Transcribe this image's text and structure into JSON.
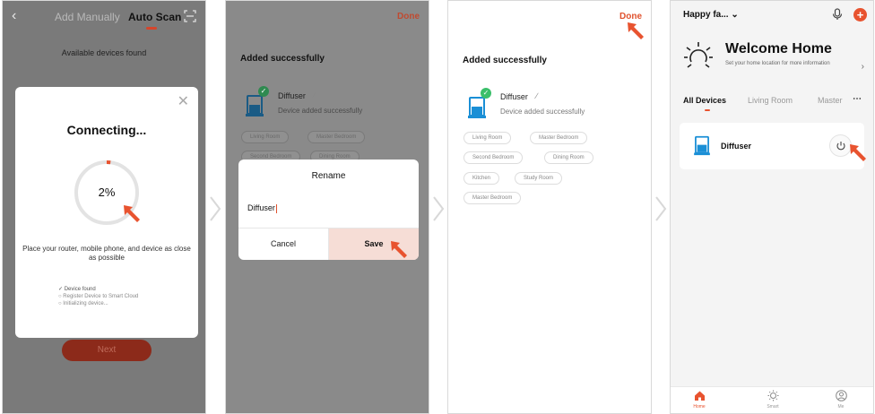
{
  "screen1": {
    "tabs": {
      "manual": "Add Manually",
      "auto": "Auto Scan"
    },
    "found_text": "Available devices found",
    "dialog": {
      "title": "Connecting...",
      "progress_text": "2%",
      "progress": 0.02,
      "note": "Place your router, mobile phone, and device as close as possible",
      "steps": [
        {
          "label": "Device found",
          "status": "done"
        },
        {
          "label": "Register Device to Smart Cloud",
          "status": "pending"
        },
        {
          "label": "Initializing device...",
          "status": "pending"
        }
      ]
    },
    "next_label": "Next"
  },
  "screen2": {
    "done_label": "Done",
    "added_title": "Added successfully",
    "device": {
      "name": "Diffuser",
      "subtitle": "Device added successfully"
    },
    "rooms": [
      "Living Room",
      "Master Bedroom",
      "Second Bedroom",
      "Dining Room"
    ],
    "rename_dialog": {
      "title": "Rename",
      "input_value": "Diffuser",
      "cancel_label": "Cancel",
      "save_label": "Save"
    }
  },
  "screen3": {
    "done_label": "Done",
    "added_title": "Added successfully",
    "device": {
      "name": "Diffuser",
      "subtitle": "Device added successfully"
    },
    "rooms": [
      "Living Room",
      "Master Bedroom",
      "Second Bedroom",
      "Dining Room",
      "Kitchen",
      "Study Room",
      "Master Bedroom"
    ]
  },
  "screen4": {
    "home_name": "Happy fa...",
    "welcome_title": "Welcome Home",
    "location_hint": "Set your home location for more information",
    "tabs": [
      "All Devices",
      "Living Room",
      "Master"
    ],
    "device_name": "Diffuser",
    "nav": [
      "Home",
      "Smart",
      "Me"
    ]
  },
  "colors": {
    "accent": "#e8532f",
    "success": "#3bbf6a",
    "device_blue": "#1a8fd6"
  }
}
